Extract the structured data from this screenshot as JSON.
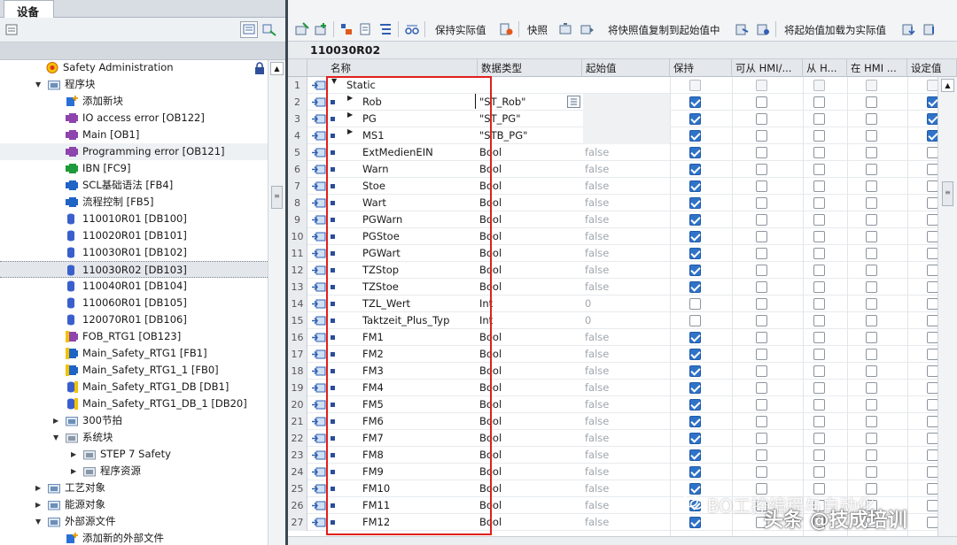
{
  "left": {
    "tab": "设备",
    "tree": [
      {
        "label": "Safety Administration",
        "indent": 0,
        "icon": "safety-admin-icon",
        "color": "#e8a000",
        "twist": ""
      },
      {
        "label": "程序块",
        "indent": 0,
        "icon": "folder-icon",
        "color": "#6d8fb8",
        "twist": "down"
      },
      {
        "label": "添加新块",
        "indent": 1,
        "icon": "add-block-icon",
        "color": "#2a6fd6",
        "twist": ""
      },
      {
        "label": "IO access error [OB122]",
        "indent": 1,
        "icon": "ob-icon",
        "color": "#8e44ad",
        "twist": ""
      },
      {
        "label": "Main [OB1]",
        "indent": 1,
        "icon": "ob-icon",
        "color": "#8e44ad",
        "twist": ""
      },
      {
        "label": "Programming error [OB121]",
        "indent": 1,
        "icon": "ob-icon",
        "color": "#8e44ad",
        "twist": "",
        "hl": true
      },
      {
        "label": "IBN [FC9]",
        "indent": 1,
        "icon": "fc-icon",
        "color": "#1e9a3a",
        "twist": ""
      },
      {
        "label": "SCL基础语法 [FB4]",
        "indent": 1,
        "icon": "fb-icon",
        "color": "#1f63c4",
        "twist": ""
      },
      {
        "label": "流程控制 [FB5]",
        "indent": 1,
        "icon": "fb-icon",
        "color": "#1f63c4",
        "twist": ""
      },
      {
        "label": "110010R01 [DB100]",
        "indent": 1,
        "icon": "db-icon",
        "color": "#3a5fcd",
        "twist": ""
      },
      {
        "label": "110020R01 [DB101]",
        "indent": 1,
        "icon": "db-icon",
        "color": "#3a5fcd",
        "twist": ""
      },
      {
        "label": "110030R01 [DB102]",
        "indent": 1,
        "icon": "db-icon",
        "color": "#3a5fcd",
        "twist": ""
      },
      {
        "label": "110030R02 [DB103]",
        "indent": 1,
        "icon": "db-icon",
        "color": "#3a5fcd",
        "twist": "",
        "sel": true
      },
      {
        "label": "110040R01 [DB104]",
        "indent": 1,
        "icon": "db-icon",
        "color": "#3a5fcd",
        "twist": ""
      },
      {
        "label": "110060R01 [DB105]",
        "indent": 1,
        "icon": "db-icon",
        "color": "#3a5fcd",
        "twist": ""
      },
      {
        "label": "120070R01 [DB106]",
        "indent": 1,
        "icon": "db-icon",
        "color": "#3a5fcd",
        "twist": ""
      },
      {
        "label": "FOB_RTG1 [OB123]",
        "indent": 1,
        "icon": "safety-ob-icon",
        "color": "#8e44ad",
        "twist": ""
      },
      {
        "label": "Main_Safety_RTG1 [FB1]",
        "indent": 1,
        "icon": "safety-fb-icon",
        "color": "#1f63c4",
        "twist": ""
      },
      {
        "label": "Main_Safety_RTG1_1 [FB0]",
        "indent": 1,
        "icon": "safety-fb-icon",
        "color": "#1f63c4",
        "twist": ""
      },
      {
        "label": "Main_Safety_RTG1_DB [DB1]",
        "indent": 1,
        "icon": "safety-db-icon",
        "color": "#3a5fcd",
        "twist": ""
      },
      {
        "label": "Main_Safety_RTG1_DB_1 [DB20]",
        "indent": 1,
        "icon": "safety-db-icon",
        "color": "#3a5fcd",
        "twist": ""
      },
      {
        "label": "300节拍",
        "indent": 1,
        "icon": "folder-icon",
        "color": "#6d8fb8",
        "twist": "right"
      },
      {
        "label": "系统块",
        "indent": 1,
        "icon": "system-folder-icon",
        "color": "#8a96a3",
        "twist": "down"
      },
      {
        "label": "STEP 7 Safety",
        "indent": 2,
        "icon": "system-folder-icon",
        "color": "#8a96a3",
        "twist": "right"
      },
      {
        "label": "程序资源",
        "indent": 2,
        "icon": "system-folder-icon",
        "color": "#8a96a3",
        "twist": "right"
      },
      {
        "label": "工艺对象",
        "indent": 0,
        "icon": "tech-object-icon",
        "color": "#6d8fb8",
        "twist": "right"
      },
      {
        "label": "能源对象",
        "indent": 0,
        "icon": "energy-object-icon",
        "color": "#6d8fb8",
        "twist": "right"
      },
      {
        "label": "外部源文件",
        "indent": 0,
        "icon": "external-source-icon",
        "color": "#6d8fb8",
        "twist": "down"
      },
      {
        "label": "添加新的外部文件",
        "indent": 1,
        "icon": "add-file-icon",
        "color": "#2a6fd6",
        "twist": ""
      }
    ]
  },
  "toolbar": {
    "keep_actual": "保持实际值",
    "snapshot": "快照",
    "copy_snapshot": "将快照值复制到起始值中",
    "load_start": "将起始值加载为实际值"
  },
  "db_title": "110030R02",
  "columns": [
    "名称",
    "数据类型",
    "起始值",
    "保持",
    "可从 HMI/...",
    "从 H...",
    "在 HMI ...",
    "设定值"
  ],
  "rows": [
    {
      "n": "1",
      "name": "Static",
      "type": "",
      "start": "",
      "keep": false,
      "c1": false,
      "c2": false,
      "c3": false,
      "set": false,
      "static": true
    },
    {
      "n": "2",
      "name": "Rob",
      "type": "\"ST_Rob\"",
      "start": "",
      "keep": true,
      "c1": false,
      "c2": false,
      "c3": false,
      "set": true,
      "expand": true,
      "shade": true
    },
    {
      "n": "3",
      "name": "PG",
      "type": "\"ST_PG\"",
      "start": "",
      "keep": true,
      "c1": false,
      "c2": false,
      "c3": false,
      "set": true,
      "expand": true,
      "shade": true
    },
    {
      "n": "4",
      "name": "MS1",
      "type": "\"STB_PG\"",
      "start": "",
      "keep": true,
      "c1": false,
      "c2": false,
      "c3": false,
      "set": true,
      "expand": true,
      "shade": true
    },
    {
      "n": "5",
      "name": "ExtMedienEIN",
      "type": "Bool",
      "start": "false",
      "keep": true,
      "c1": false,
      "c2": false,
      "c3": false,
      "set": false
    },
    {
      "n": "6",
      "name": "Warn",
      "type": "Bool",
      "start": "false",
      "keep": true,
      "c1": false,
      "c2": false,
      "c3": false,
      "set": false
    },
    {
      "n": "7",
      "name": "Stoe",
      "type": "Bool",
      "start": "false",
      "keep": true,
      "c1": false,
      "c2": false,
      "c3": false,
      "set": false
    },
    {
      "n": "8",
      "name": "Wart",
      "type": "Bool",
      "start": "false",
      "keep": true,
      "c1": false,
      "c2": false,
      "c3": false,
      "set": false
    },
    {
      "n": "9",
      "name": "PGWarn",
      "type": "Bool",
      "start": "false",
      "keep": true,
      "c1": false,
      "c2": false,
      "c3": false,
      "set": false
    },
    {
      "n": "10",
      "name": "PGStoe",
      "type": "Bool",
      "start": "false",
      "keep": true,
      "c1": false,
      "c2": false,
      "c3": false,
      "set": false
    },
    {
      "n": "11",
      "name": "PGWart",
      "type": "Bool",
      "start": "false",
      "keep": true,
      "c1": false,
      "c2": false,
      "c3": false,
      "set": false
    },
    {
      "n": "12",
      "name": "TZStop",
      "type": "Bool",
      "start": "false",
      "keep": true,
      "c1": false,
      "c2": false,
      "c3": false,
      "set": false
    },
    {
      "n": "13",
      "name": "TZStoe",
      "type": "Bool",
      "start": "false",
      "keep": true,
      "c1": false,
      "c2": false,
      "c3": false,
      "set": false
    },
    {
      "n": "14",
      "name": "TZL_Wert",
      "type": "Int",
      "start": "0",
      "keep": false,
      "c1": false,
      "c2": false,
      "c3": false,
      "set": false
    },
    {
      "n": "15",
      "name": "Taktzeit_Plus_Typ",
      "type": "Int",
      "start": "0",
      "keep": false,
      "c1": false,
      "c2": false,
      "c3": false,
      "set": false
    },
    {
      "n": "16",
      "name": "FM1",
      "type": "Bool",
      "start": "false",
      "keep": true,
      "c1": false,
      "c2": false,
      "c3": false,
      "set": false
    },
    {
      "n": "17",
      "name": "FM2",
      "type": "Bool",
      "start": "false",
      "keep": true,
      "c1": false,
      "c2": false,
      "c3": false,
      "set": false
    },
    {
      "n": "18",
      "name": "FM3",
      "type": "Bool",
      "start": "false",
      "keep": true,
      "c1": false,
      "c2": false,
      "c3": false,
      "set": false
    },
    {
      "n": "19",
      "name": "FM4",
      "type": "Bool",
      "start": "false",
      "keep": true,
      "c1": false,
      "c2": false,
      "c3": false,
      "set": false
    },
    {
      "n": "20",
      "name": "FM5",
      "type": "Bool",
      "start": "false",
      "keep": true,
      "c1": false,
      "c2": false,
      "c3": false,
      "set": false
    },
    {
      "n": "21",
      "name": "FM6",
      "type": "Bool",
      "start": "false",
      "keep": true,
      "c1": false,
      "c2": false,
      "c3": false,
      "set": false
    },
    {
      "n": "22",
      "name": "FM7",
      "type": "Bool",
      "start": "false",
      "keep": true,
      "c1": false,
      "c2": false,
      "c3": false,
      "set": false
    },
    {
      "n": "23",
      "name": "FM8",
      "type": "Bool",
      "start": "false",
      "keep": true,
      "c1": false,
      "c2": false,
      "c3": false,
      "set": false
    },
    {
      "n": "24",
      "name": "FM9",
      "type": "Bool",
      "start": "false",
      "keep": true,
      "c1": false,
      "c2": false,
      "c3": false,
      "set": false
    },
    {
      "n": "25",
      "name": "FM10",
      "type": "Bool",
      "start": "false",
      "keep": true,
      "c1": false,
      "c2": false,
      "c3": false,
      "set": false
    },
    {
      "n": "26",
      "name": "FM11",
      "type": "Bool",
      "start": "false",
      "keep": true,
      "c1": false,
      "c2": false,
      "c3": false,
      "set": false
    },
    {
      "n": "27",
      "name": "FM12",
      "type": "Bool",
      "start": "false",
      "keep": true,
      "c1": false,
      "c2": false,
      "c3": false,
      "set": false
    }
  ],
  "watermark": {
    "line1": "BO工控编程与自动化",
    "line2": "头条 @技成培训"
  },
  "colors": {
    "accent": "#2f73c9",
    "highlight_box": "#e0201b"
  }
}
